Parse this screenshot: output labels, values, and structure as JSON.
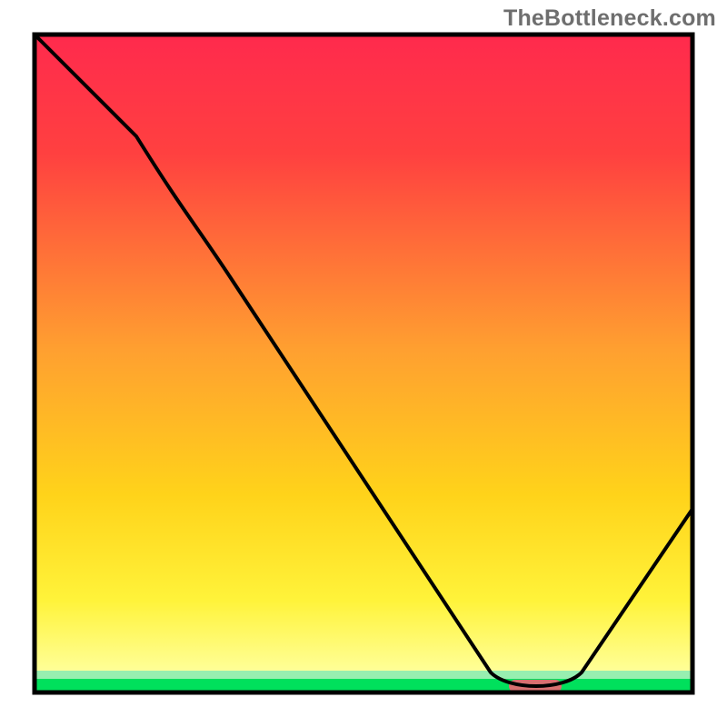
{
  "watermark": "TheBottleneck.com",
  "colors": {
    "gradient_top": "#ff2a4d",
    "gradient_mid": "#ffd31a",
    "gradient_bottom": "#ffff9a",
    "baseline_green": "#00e05c",
    "optimal_marker": "#d87070",
    "curve": "#000000",
    "frame": "#000000"
  },
  "chart_data": {
    "type": "line",
    "title": "",
    "xlabel": "",
    "ylabel": "",
    "xlim": [
      0,
      100
    ],
    "ylim": [
      0,
      100
    ],
    "grid": false,
    "legend": false,
    "annotations": [
      {
        "name": "optimal-marker",
        "x": 79,
        "y": 0,
        "shape": "pill",
        "color": "#d87070"
      }
    ],
    "series": [
      {
        "name": "bottleneck-curve",
        "color": "#000000",
        "x": [
          0,
          15,
          29,
          69,
          79,
          83,
          100
        ],
        "y": [
          100,
          85,
          59,
          2,
          0,
          2,
          28
        ],
        "notes": "y is % bottleneck; curve hits 0 around x≈79 (optimal), rises toward both ends"
      }
    ],
    "background": {
      "type": "vertical-gradient",
      "stops": [
        {
          "pos": 0.0,
          "color": "#ff2a4d"
        },
        {
          "pos": 0.48,
          "color": "#ffa030"
        },
        {
          "pos": 0.86,
          "color": "#fff33a"
        },
        {
          "pos": 1.0,
          "color": "#ffffe8"
        }
      ],
      "baseline_band": {
        "color": "#00e05c",
        "height_frac": 0.022
      }
    }
  }
}
